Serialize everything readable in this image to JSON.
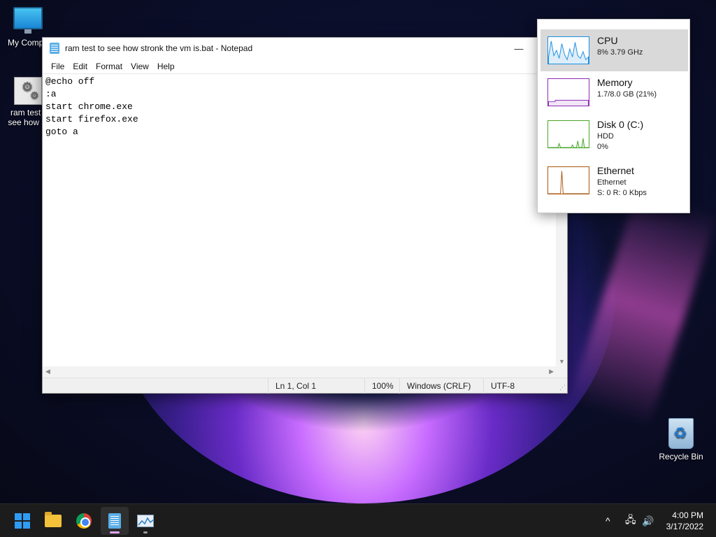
{
  "desktop": {
    "icons": [
      {
        "label": "My Compu",
        "icon": "monitor-icon"
      },
      {
        "label": "ram test t\nsee how st",
        "icon": "batch-file-icon"
      },
      {
        "label": "Recycle Bin",
        "icon": "recycle-bin-icon"
      }
    ]
  },
  "notepad": {
    "title": "ram test to see how stronk the vm is.bat - Notepad",
    "controls": {
      "minimize": "—",
      "maximize": "☐"
    },
    "menu": [
      "File",
      "Edit",
      "Format",
      "View",
      "Help"
    ],
    "lines": [
      "@echo off",
      ":a",
      "start chrome.exe",
      "start firefox.exe",
      "goto a"
    ],
    "status": {
      "position": "Ln 1, Col 1",
      "zoom": "100%",
      "line_ending": "Windows (CRLF)",
      "encoding": "UTF-8"
    }
  },
  "perf": {
    "items": [
      {
        "name": "CPU",
        "line1": "8% 3.79 GHz",
        "line2": "",
        "color": "#1a8ee0",
        "selected": true
      },
      {
        "name": "Memory",
        "line1": "1.7/8.0 GB (21%)",
        "line2": "",
        "color": "#8b2bb5"
      },
      {
        "name": "Disk 0 (C:)",
        "line1": "HDD",
        "line2": "0%",
        "color": "#4aa52a"
      },
      {
        "name": "Ethernet",
        "line1": "Ethernet",
        "line2": "S: 0 R: 0 Kbps",
        "color": "#a9570f"
      }
    ]
  },
  "taskbar": {
    "apps": [
      "start-icon",
      "file-explorer-icon",
      "chrome-icon",
      "notepad-icon",
      "task-manager-icon"
    ],
    "tray": {
      "chevron": "^",
      "network": "🖧",
      "volume": "🔊"
    },
    "time": "4:00 PM",
    "date": "3/17/2022"
  }
}
